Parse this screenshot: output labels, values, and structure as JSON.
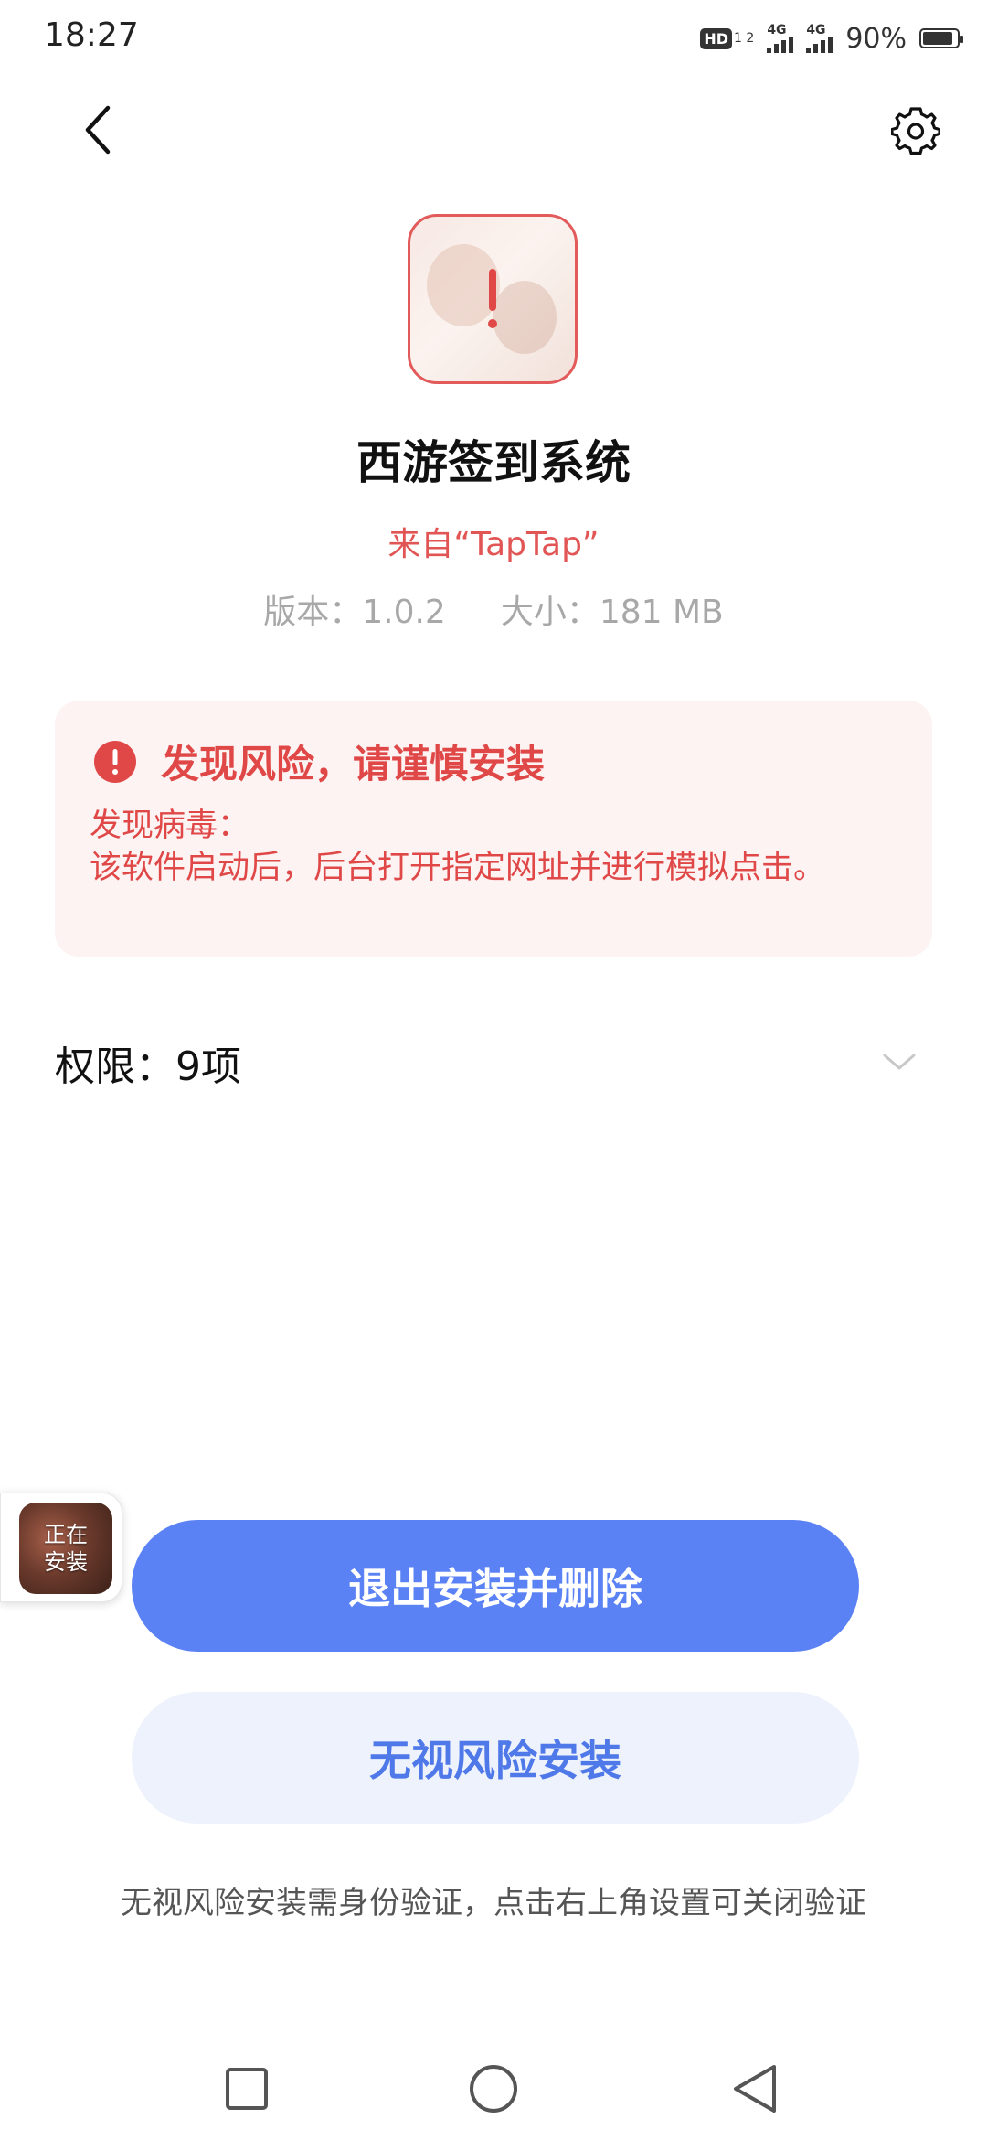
{
  "status_bar": {
    "time": "18:27",
    "hd_label": "HD",
    "hd_sub": "1 2",
    "signal1_label": "4G",
    "signal2_label": "4G",
    "battery_percent": "90%",
    "battery_level": 0.9
  },
  "nav": {
    "back_icon": "chevron-left-icon",
    "settings_icon": "gear-icon"
  },
  "app": {
    "name": "西游签到系统",
    "source": "来自“TapTap”",
    "version": "版本：1.0.2",
    "size": "大小：181 MB"
  },
  "risk": {
    "title": "发现风险，请谨慎安装",
    "body_line1": "发现病毒：",
    "body_line2": "该软件启动后，后台打开指定网址并进行模拟点击。",
    "accent_color": "#e04848"
  },
  "permissions": {
    "label": "权限：9项"
  },
  "installing_badge": {
    "line1": "正在",
    "line2": "安装"
  },
  "buttons": {
    "exit_delete": "退出安装并删除",
    "ignore_install": "无视风险安装",
    "primary_color": "#5b82f5"
  },
  "footnote": "无视风险安装需身份验证，点击右上角设置可关闭验证",
  "system_nav": {
    "recents_icon": "square-icon",
    "home_icon": "circle-icon",
    "back_icon": "triangle-back-icon"
  }
}
